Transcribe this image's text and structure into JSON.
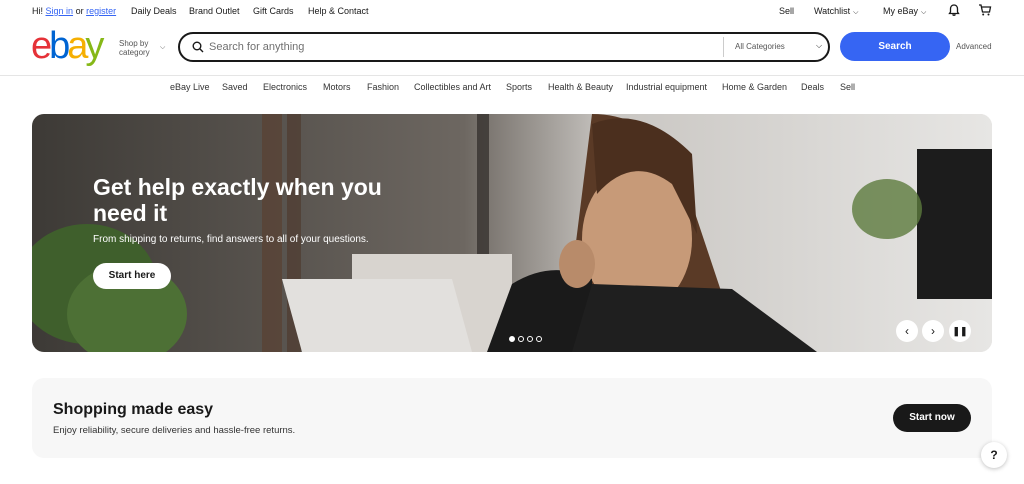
{
  "topbar": {
    "greeting": "Hi!",
    "sign_in": "Sign in",
    "or": "or",
    "register": "register",
    "left_links": [
      "Daily Deals",
      "Brand Outlet",
      "Gift Cards",
      "Help & Contact"
    ],
    "sell": "Sell",
    "watchlist": "Watchlist",
    "my_ebay": "My eBay",
    "icons": [
      "bell-icon",
      "cart-icon"
    ]
  },
  "header": {
    "logo_letters": [
      "e",
      "b",
      "a",
      "y"
    ],
    "logo_colors": [
      "#e53238",
      "#0064d2",
      "#f5af02",
      "#86b817"
    ],
    "shop_by_line1": "Shop by",
    "shop_by_line2": "category",
    "search_placeholder": "Search for anything",
    "category_select": "All Categories",
    "search_button": "Search",
    "advanced": "Advanced"
  },
  "nav": [
    "eBay Live",
    "Saved",
    "Electronics",
    "Motors",
    "Fashion",
    "Collectibles and Art",
    "Sports",
    "Health & Beauty",
    "Industrial equipment",
    "Home & Garden",
    "Deals",
    "Sell"
  ],
  "hero": {
    "title": "Get help exactly when you need it",
    "subtitle": "From shipping to returns, find answers to all of your questions.",
    "cta": "Start here",
    "slide_count": 4,
    "active_slide": 1,
    "controls": [
      "chevron-left-icon",
      "chevron-right-icon",
      "pause-icon"
    ]
  },
  "band": {
    "title": "Shopping made easy",
    "subtitle": "Enjoy reliability, secure deliveries and hassle-free returns.",
    "cta": "Start now"
  },
  "help_button": "?",
  "colors": {
    "accent": "#3665f3",
    "text": "#191919",
    "band_bg": "#f7f7f7"
  }
}
